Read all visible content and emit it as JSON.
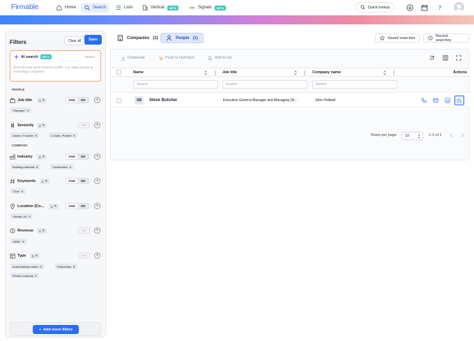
{
  "app": {
    "logo": "Firmable"
  },
  "nav": {
    "items": [
      {
        "label": "Home",
        "icon": "home-icon"
      },
      {
        "label": "Search",
        "icon": "search-icon",
        "active": true
      },
      {
        "label": "Lists",
        "icon": "list-icon"
      },
      {
        "label": "Vertical",
        "icon": "building-icon",
        "badge": "BETA"
      },
      {
        "label": "Signals",
        "icon": "signal-icon",
        "badge": "BETA"
      }
    ],
    "quick_lookup": "Quick lookup"
  },
  "colors": {
    "accent": "#2a6df4",
    "beta_badge": "#3fc7c0",
    "ai_border": "#f2a77a"
  },
  "filters": {
    "title": "Filters",
    "clear_all": "Clear all",
    "save": "Save",
    "ai": {
      "title": "AI search",
      "badge": "BETA",
      "search": "Search",
      "placeholder": "Describe your ideal customer profile, e.g. Sales people at technology companies."
    },
    "section_people": "PEOPLE",
    "section_company": "COMPANY",
    "job_title": {
      "label": "Job title",
      "count": "1",
      "and": "AND",
      "or": "OR",
      "chips": [
        "\"Manager\""
      ]
    },
    "seniority": {
      "label": "Seniority",
      "count": "2",
      "or": "OR",
      "chips": [
        "Owner / Founder",
        "C-Suite / Partner"
      ]
    },
    "industry": {
      "label": "Industry",
      "count": "2",
      "and": "AND",
      "or": "OR",
      "chips": [
        "Building materials",
        "Construction"
      ]
    },
    "keywords": {
      "label": "Keywords",
      "count": "1",
      "and": "AND",
      "or": "OR",
      "chips": [
        "\"Civil\""
      ]
    },
    "location": {
      "label": "Location (Co...",
      "count": "1",
      "and": "AND",
      "or": "OR",
      "chips": [
        "Victoria, AU"
      ]
    },
    "revenue": {
      "label": "Revenue",
      "count": "1",
      "or": "OR",
      "chips": [
        ">$1B+"
      ]
    },
    "type": {
      "label": "Type",
      "count": "3",
      "or": "OR",
      "chips": [
        "Individual/sole trader",
        "Partnership",
        "Private company"
      ]
    },
    "add_more": "Add more filters"
  },
  "main": {
    "tabs": [
      {
        "label": "Companies",
        "count": "(1)"
      },
      {
        "label": "People",
        "count": "(1)"
      }
    ],
    "saved_searches": "Saved searches",
    "recent_searches": "Recent searches",
    "toolbar": {
      "download": "Download",
      "hubspot": "Push to HubSpot",
      "add_list": "Add to list"
    },
    "columns": [
      "Name",
      "Job title",
      "Company name",
      "Actions"
    ],
    "search_placeholder": "Search",
    "rows": [
      {
        "initials": "SB",
        "name": "Steve Butcher",
        "job_title": "Executive General Manager and Managing Dir...",
        "company": "John Holland"
      }
    ],
    "rows_per_page_label": "Rows per page",
    "rows_per_page": "10",
    "range": "1-1 of 1"
  }
}
